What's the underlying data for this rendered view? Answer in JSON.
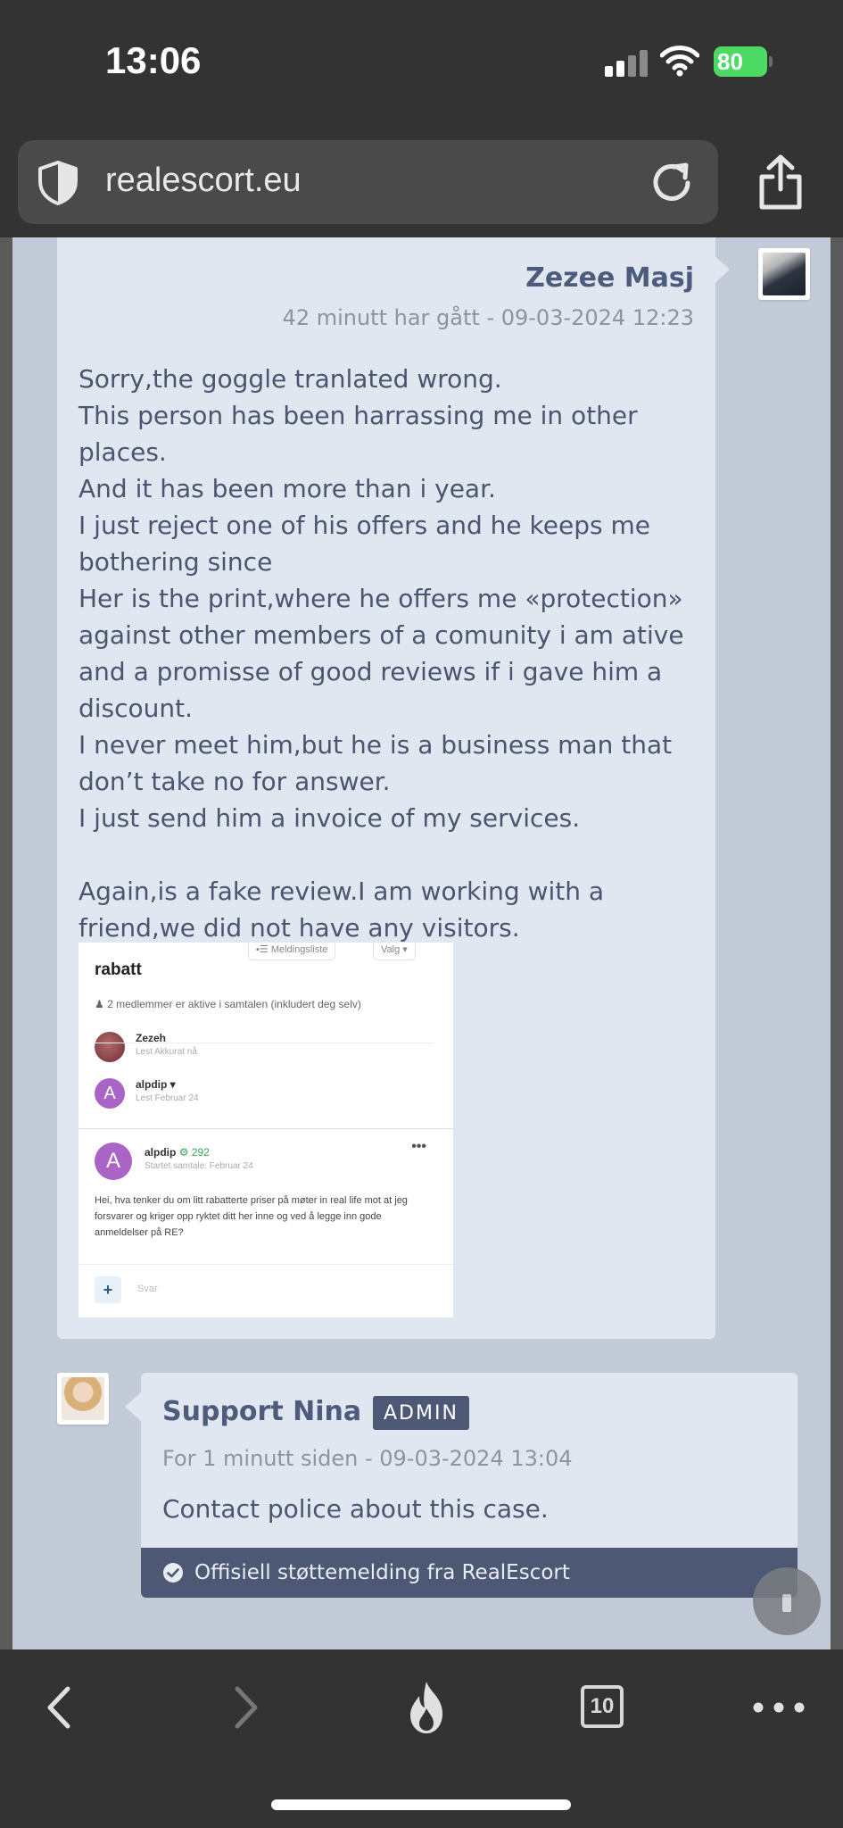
{
  "status_bar": {
    "time": "13:06",
    "battery": "80",
    "battery_color": "#4cd964"
  },
  "browser": {
    "url": "realescort.eu",
    "tab_count": "10",
    "icons": [
      "shield-icon",
      "reload-icon",
      "share-icon",
      "back-icon",
      "forward-icon",
      "fire-icon",
      "tabs-icon",
      "more-icon"
    ]
  },
  "messages": [
    {
      "author": "Zezee Masj",
      "time": "42 minutt har gått - 09-03-2024 12:23",
      "text": "Sorry,the goggle tranlated wrong.\nThis person has been harrassing me in other places.\nAnd it has been more than i year.\nI just reject one of his offers and he keeps me bothering since\nHer is the print,where he offers me «protection» against other members of a comunity i am ative and a promisse of good reviews if i gave him a discount.\nI never meet him,but he is a business man that don’t take no for answer.\nI just send him a invoice of my services.\n\nAgain,is a fake review.I am working with a friend,we did not have any visitors.",
      "attachment": {
        "toolbar_list": "Meldingsliste",
        "toolbar_choose": "Valg",
        "title": "rabatt",
        "members_line": "2 medlemmer er aktive i samtalen (inkludert deg selv)",
        "participants": [
          {
            "name": "Zezeh",
            "sub": "Lest Akkurat nå",
            "initial": ""
          },
          {
            "name": "alpdip",
            "sub": "Lest Februar 24",
            "initial": "A"
          }
        ],
        "message_author": "alpdip",
        "message_score": "292",
        "message_started": "Startet samtale: Februar 24",
        "message_text": "Hei, hva tenker du om litt rabatterte priser på møter in real life mot at jeg forsvarer og kriger opp ryktet ditt her inne og ved å legge inn gode anmeldelser på RE?",
        "input_placeholder": "Svar"
      }
    },
    {
      "author": "Support Nina",
      "badge": "ADMIN",
      "time": "For 1 minutt siden - 09-03-2024 13:04",
      "text": "Contact police about this case.",
      "official_note": "Offisiell støttemelding fra RealEscort"
    }
  ],
  "colors": {
    "chrome": "#333333",
    "page_bg": "#c4cbd8",
    "bubble": "#e1e7f0",
    "accent": "#4d5875",
    "author": "#4d5b7c"
  }
}
